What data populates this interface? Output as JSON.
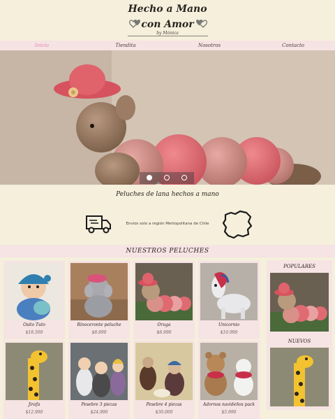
{
  "logo": {
    "line1": "Hecho a Mano",
    "line2": "con Amor",
    "byline": "by Mónica"
  },
  "nav": [
    "Inicio",
    "Tiendita",
    "Nosotros",
    "Contacto"
  ],
  "nav_active": "Inicio",
  "tagline": "Peluches de lana hechos a mano",
  "shipping": {
    "text": "Envíos solo a región Metropolitana de Chile",
    "icons": [
      "truck-icon",
      "chile-region-map-icon"
    ]
  },
  "section_title": "NUESTROS PELUCHES",
  "products": [
    {
      "name": "Osito Tuto",
      "price": "$18.500"
    },
    {
      "name": "Rinoceronte peluche",
      "price": "$8.990"
    },
    {
      "name": "Oruga",
      "price": "$8.990"
    },
    {
      "name": "Unicornio",
      "price": "$10.990"
    },
    {
      "name": "Jirafa",
      "price": "$12.990"
    },
    {
      "name": "Pesebre 3 piezas",
      "price": "$24.990"
    },
    {
      "name": "Pesebre 4 piezas",
      "price": "$30.000"
    },
    {
      "name": "Adornos navideños pack",
      "price": "$5.990"
    }
  ],
  "sidebar": {
    "popular_label": "POPULARES",
    "new_label": "NUEVOS"
  },
  "colors": {
    "background": "#f5efdc",
    "pink_bar": "#f6e3e3",
    "active_nav": "#e08ab5"
  },
  "carousel": {
    "slides": 3,
    "active_slide": 1
  }
}
